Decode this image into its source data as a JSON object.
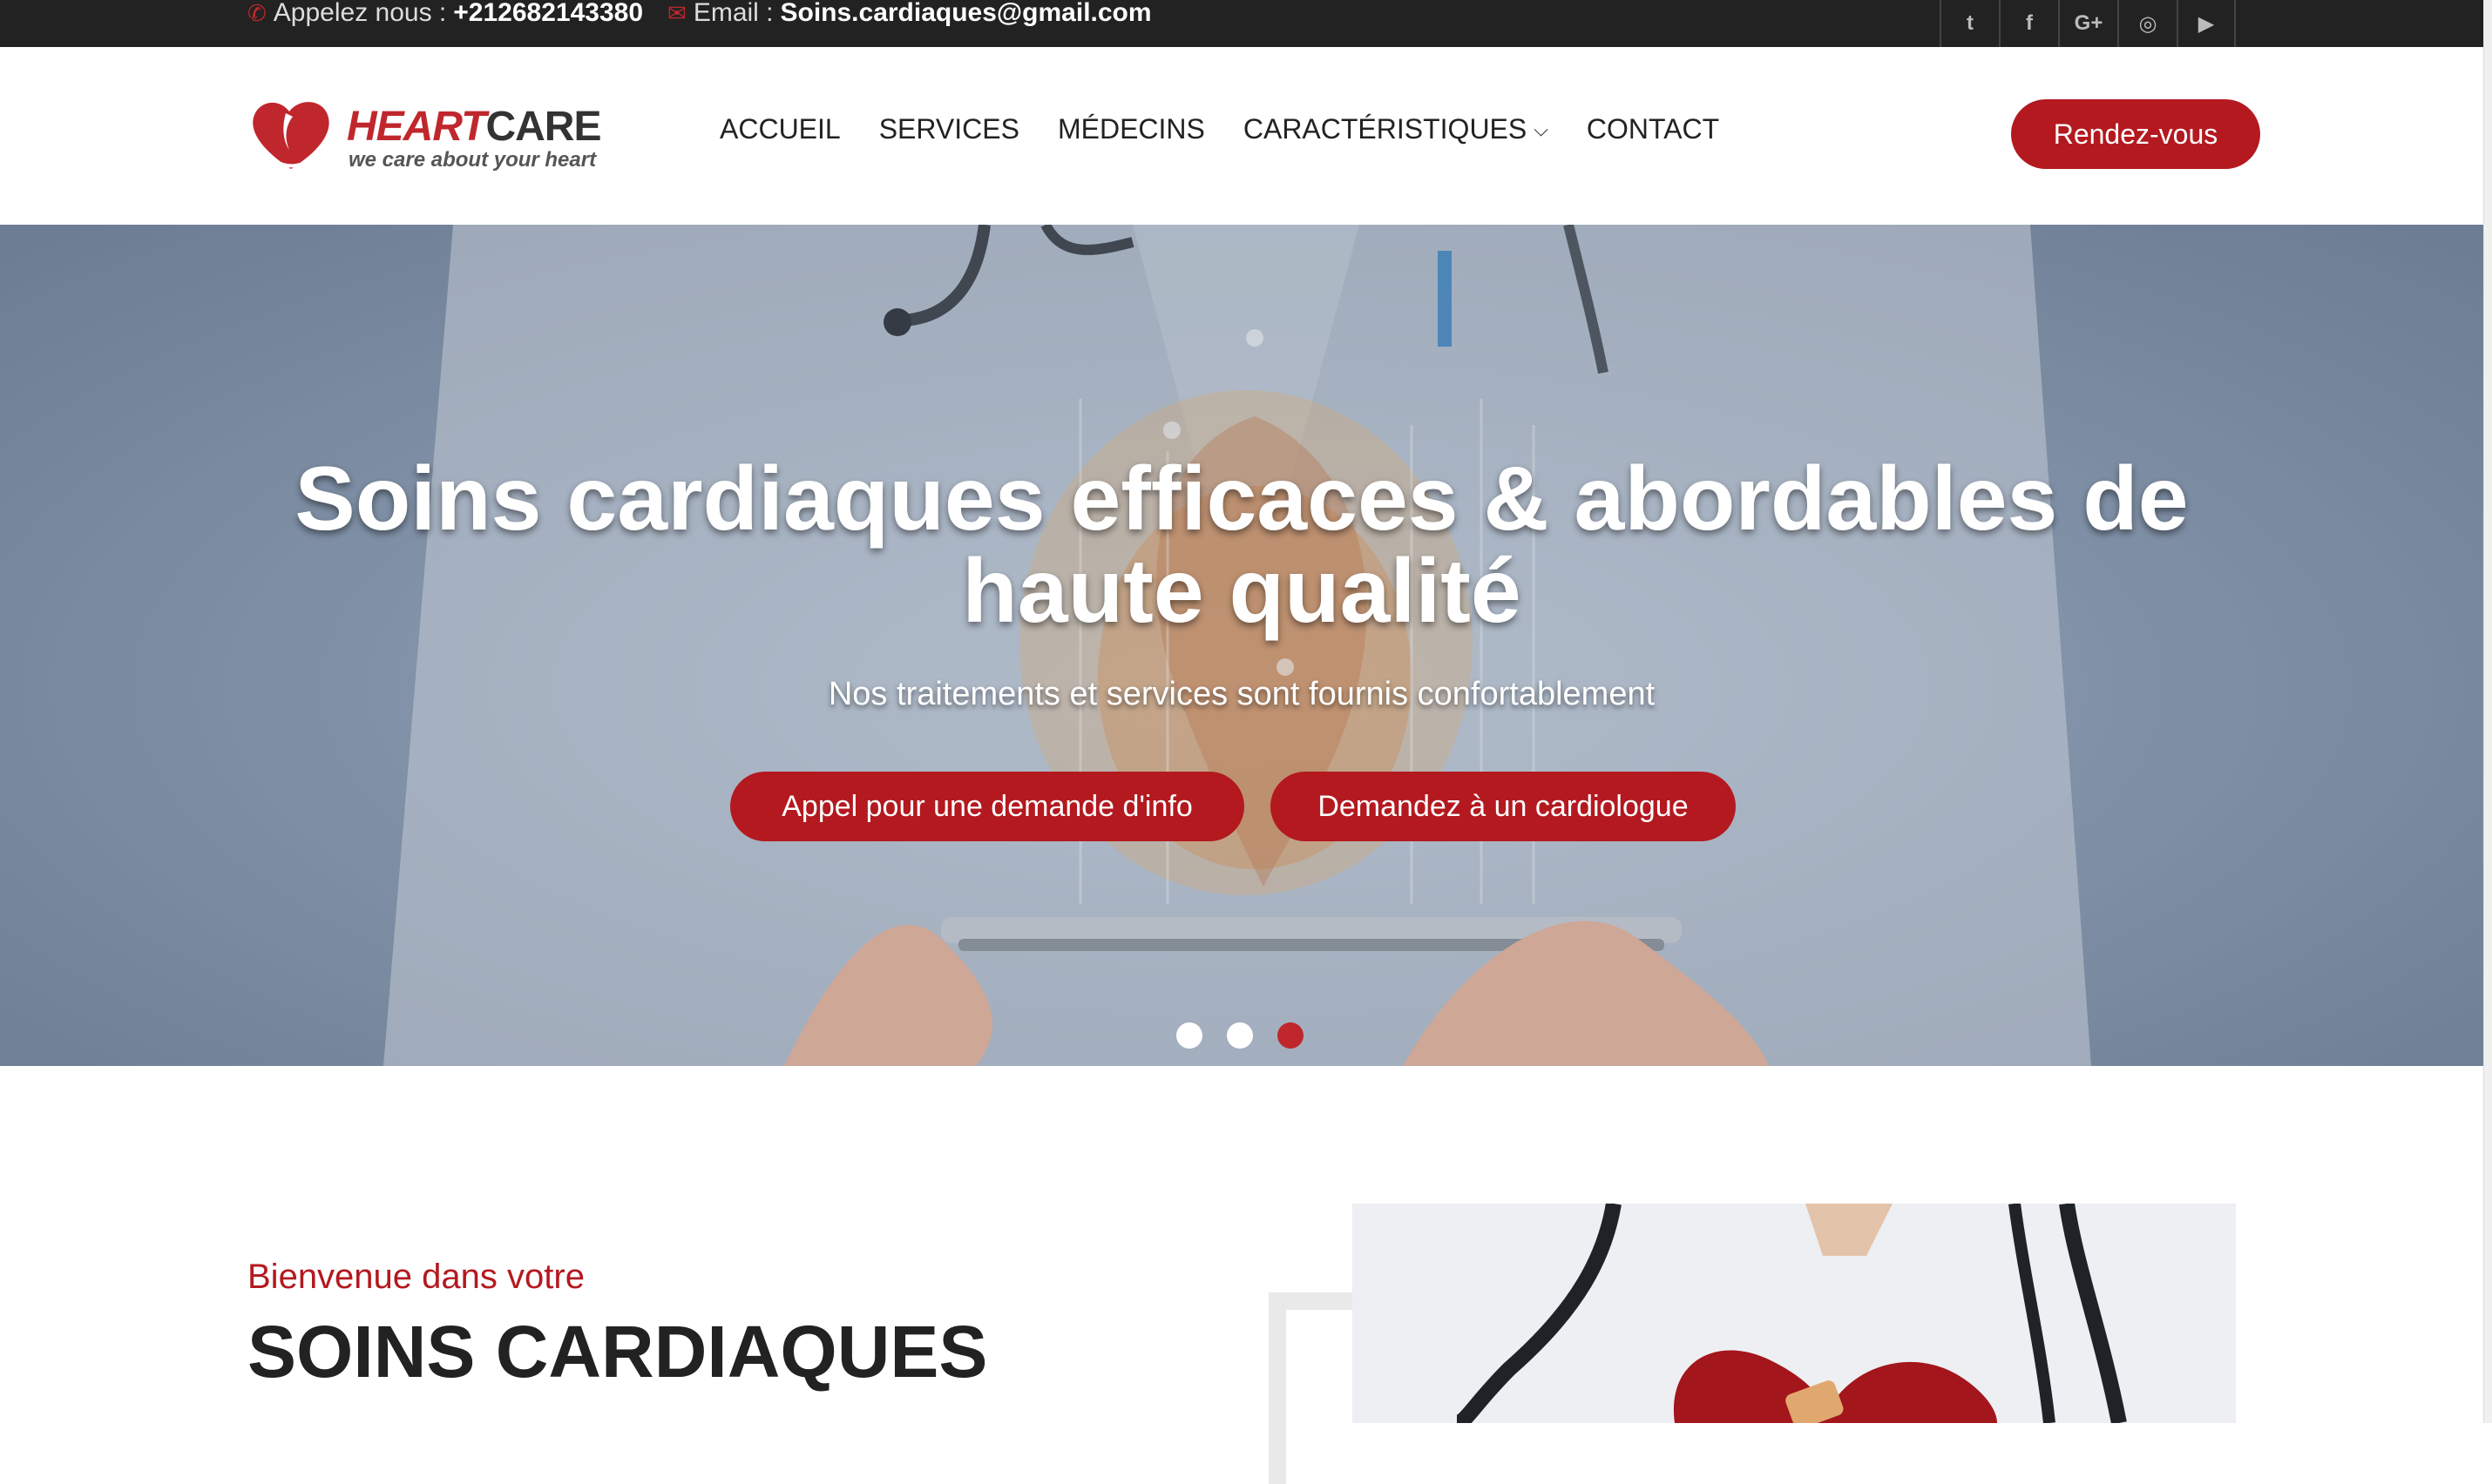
{
  "topbar": {
    "call_label": "Appelez nous :",
    "call_value": "+212682143380",
    "email_label": "Email :",
    "email_value": "Soins.cardiaques@gmail.com",
    "socials": [
      {
        "icon": "twitter-icon",
        "glyph": "t"
      },
      {
        "icon": "facebook-icon",
        "glyph": "f"
      },
      {
        "icon": "google-plus-icon",
        "glyph": "G+"
      },
      {
        "icon": "instagram-icon",
        "glyph": "◎"
      },
      {
        "icon": "youtube-icon",
        "glyph": "▶"
      }
    ]
  },
  "logo": {
    "name_part1": "HEART",
    "name_part2": "CARE",
    "tagline": "we care about your heart"
  },
  "nav": {
    "items": [
      "ACCUEIL",
      "SERVICES",
      "MÉDECINS",
      "CARACTÉRISTIQUES",
      "CONTACT"
    ],
    "cta": "Rendez-vous"
  },
  "hero": {
    "title": "Soins cardiaques efficaces & abordables de haute qualité",
    "subtitle": "Nos traitements et services sont fournis confortablement",
    "button_primary": "Appel pour une demande d'info",
    "button_secondary": "Demandez à un cardiologue",
    "slides_total": 3,
    "active_slide": 3
  },
  "welcome": {
    "kicker": "Bienvenue dans votre",
    "title": "SOINS CARDIAQUES"
  },
  "colors": {
    "brand_red": "#b3191f",
    "topbar_bg": "#222222",
    "text_dark": "#222222"
  }
}
